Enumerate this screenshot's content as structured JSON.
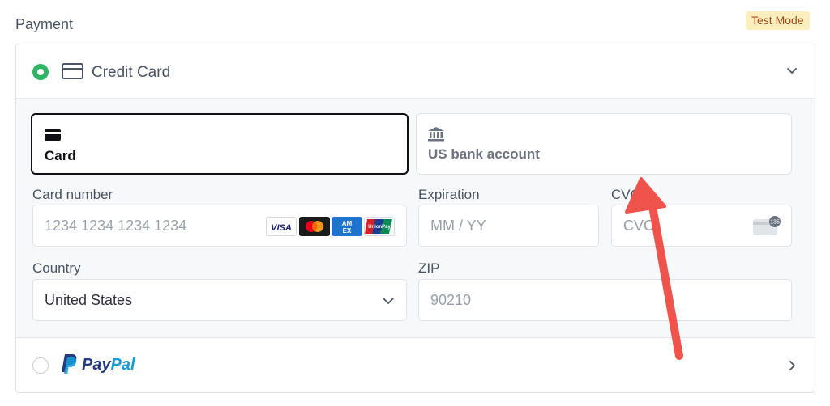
{
  "section": {
    "title": "Payment",
    "badge": "Test Mode"
  },
  "credit_card": {
    "label": "Credit Card",
    "selected": true,
    "icon": "credit-card-icon",
    "expand_icon": "chevron-down-icon"
  },
  "tabs": [
    {
      "label": "Card",
      "icon": "card-icon",
      "selected": true
    },
    {
      "label": "US bank account",
      "icon": "bank-icon",
      "selected": false
    }
  ],
  "fields": {
    "card_number": {
      "label": "Card number",
      "placeholder": "1234 1234 1234 1234",
      "brands": [
        "VISA",
        "Mastercard",
        "AMEX",
        "UnionPay"
      ]
    },
    "expiration": {
      "label": "Expiration",
      "placeholder": "MM / YY"
    },
    "cvc": {
      "label": "CVC",
      "placeholder": "CVC",
      "icon": "cvc-card-icon",
      "icon_text": "135"
    },
    "country": {
      "label": "Country",
      "value": "United States"
    },
    "zip": {
      "label": "ZIP",
      "placeholder": "90210"
    }
  },
  "paypal": {
    "label_pay": "Pay",
    "label_pal": "Pal",
    "selected": false,
    "icon": "chevron-right-icon"
  },
  "colors": {
    "accent_green": "#2fb565",
    "annotation_arrow": "#f0524c",
    "badge_bg": "#fcefbd",
    "badge_text": "#a0481b"
  }
}
